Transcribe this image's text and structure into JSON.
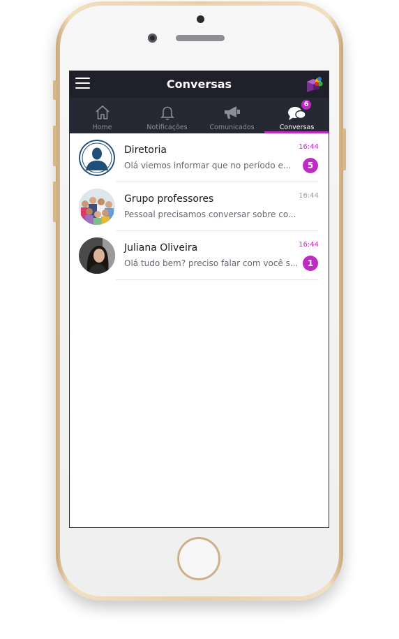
{
  "header": {
    "title": "Conversas"
  },
  "tabs": [
    {
      "label": "Home",
      "icon": "home-icon"
    },
    {
      "label": "Notificações",
      "icon": "bell-icon"
    },
    {
      "label": "Comunicados",
      "icon": "megaphone-icon"
    },
    {
      "label": "Conversas",
      "icon": "chat-bubbles-icon",
      "badge": "6",
      "active": true
    }
  ],
  "conversations": [
    {
      "name": "Diretoria",
      "preview": "Olá viemos informar que no período e...",
      "time": "16:44",
      "unread": "5"
    },
    {
      "name": "Grupo professores",
      "preview": "Pessoal precisamos conversar sobre co...",
      "time": "16:44",
      "unread": ""
    },
    {
      "name": "Juliana Oliveira",
      "preview": "Olá tudo bem? preciso falar com você s...",
      "time": "16:44",
      "unread": "1"
    }
  ],
  "colors": {
    "accent": "#c02bc6",
    "header_bg": "#1f2029",
    "tab_bg": "#262833"
  }
}
